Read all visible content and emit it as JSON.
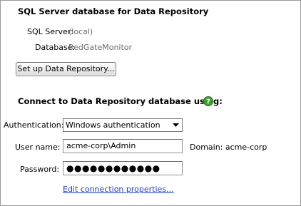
{
  "repository_section": {
    "title": "SQL Server database for Data Repository",
    "sql_server_label": "SQL Server:",
    "sql_server_value": "(local)",
    "database_label": "Database:",
    "database_value": "RedGateMonitor",
    "setup_button_label": "Set up Data Repository..."
  },
  "connect_section": {
    "title": "Connect to Data Repository database using:",
    "help_icon": "help-icon",
    "help_icon_color": "#3aa02a",
    "authentication_label": "Authentication:",
    "authentication_value": "Windows authentication",
    "username_label": "User name:",
    "username_value": "acme-corp\\Admin",
    "domain_text": "Domain: acme-corp",
    "password_label": "Password:",
    "password_value": "●●●●●●●●●●●●",
    "edit_link_label": "Edit connection properties..."
  },
  "colors": {
    "link": "#1b3fd6",
    "muted_value": "#6d6d6d",
    "border": "#9a9a9a"
  }
}
